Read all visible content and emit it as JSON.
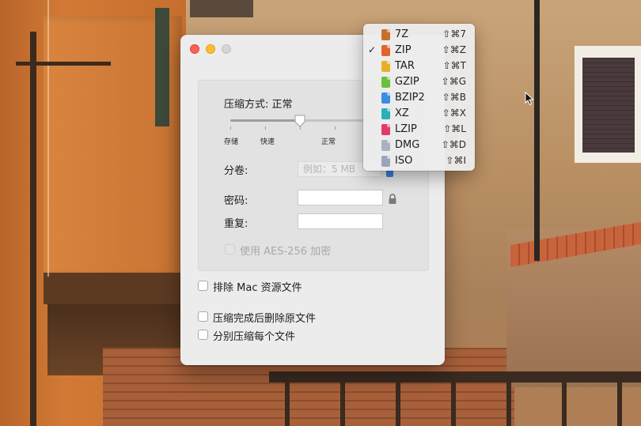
{
  "window": {
    "compression_label": "压缩方式: 正常",
    "slider": {
      "stops": [
        "存储",
        "快速",
        "正常"
      ],
      "selected": "正常",
      "level": 0.5
    },
    "split_label": "分卷:",
    "split_placeholder": "例如：5 MB",
    "password_label": "密码:",
    "password_value": "",
    "repeat_label": "重复:",
    "repeat_value": "",
    "aes_label": "使用 AES-256 加密",
    "exclude_mac_label": "排除 Mac 资源文件",
    "delete_after_label": "压缩完成后删除原文件",
    "separate_label": "分别压缩每个文件"
  },
  "format_menu": {
    "items": [
      {
        "label": "7Z",
        "shortcut": "⇧⌘7",
        "color": "#c8702a",
        "checked": false
      },
      {
        "label": "ZIP",
        "shortcut": "⇧⌘Z",
        "color": "#e0642c",
        "checked": true
      },
      {
        "label": "TAR",
        "shortcut": "⇧⌘T",
        "color": "#e8b02a",
        "checked": false
      },
      {
        "label": "GZIP",
        "shortcut": "⇧⌘G",
        "color": "#6cbf3a",
        "checked": false
      },
      {
        "label": "BZIP2",
        "shortcut": "⇧⌘B",
        "color": "#3a8ee0",
        "checked": false
      },
      {
        "label": "XZ",
        "shortcut": "⇧⌘X",
        "color": "#2ab0b8",
        "checked": false
      },
      {
        "label": "LZIP",
        "shortcut": "⇧⌘L",
        "color": "#e03a6a",
        "checked": false
      },
      {
        "label": "DMG",
        "shortcut": "⇧⌘D",
        "color": "#a8b2c0",
        "checked": false
      },
      {
        "label": "ISO",
        "shortcut": "⇧⌘I",
        "color": "#9aa6b8",
        "checked": false
      }
    ],
    "check_glyph": "✓"
  }
}
